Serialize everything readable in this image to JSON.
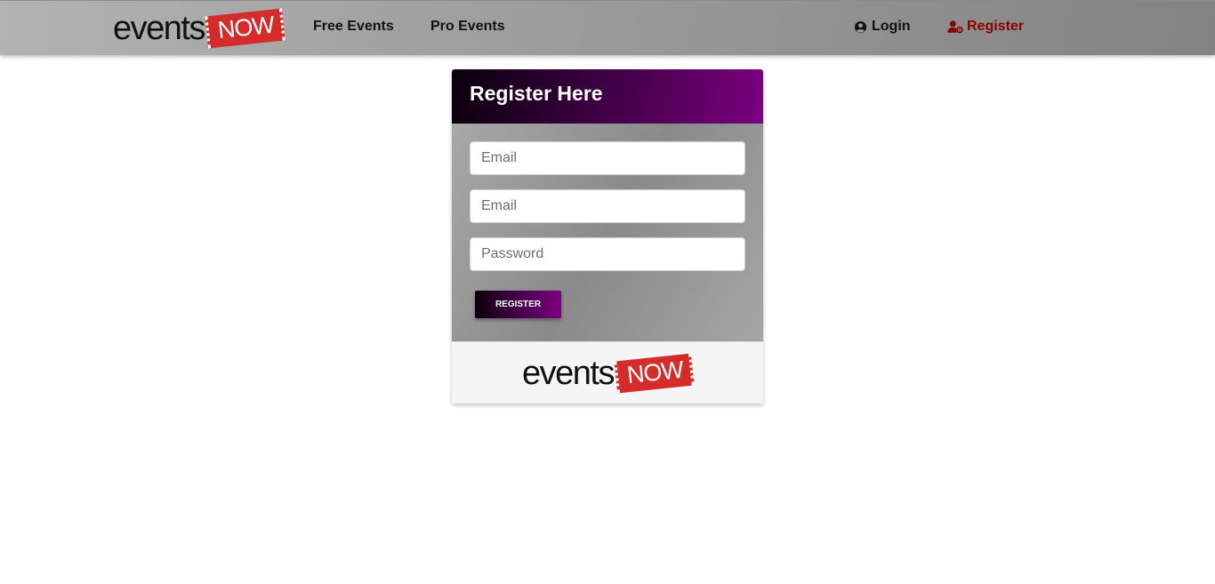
{
  "navbar": {
    "brand_text": "events",
    "brand_badge": "NOW",
    "links": [
      {
        "label": "Free Events"
      },
      {
        "label": "Pro Events"
      }
    ],
    "login_label": "Login",
    "login_icon": "user-circle-icon",
    "register_label": "Register",
    "register_icon": "user-cog-icon",
    "register_color": "#8b0000"
  },
  "form": {
    "title": "Register Here",
    "fields": [
      {
        "placeholder": "Email",
        "value": ""
      },
      {
        "placeholder": "Email",
        "value": ""
      },
      {
        "placeholder": "Password",
        "value": ""
      }
    ],
    "submit_label": "REGISTER"
  },
  "footer": {
    "brand_text": "events",
    "brand_badge": "NOW"
  },
  "colors": {
    "accent": "#7b007f",
    "brand_red": "#d62b2b",
    "navbar_gray": "#9c9c9c"
  }
}
